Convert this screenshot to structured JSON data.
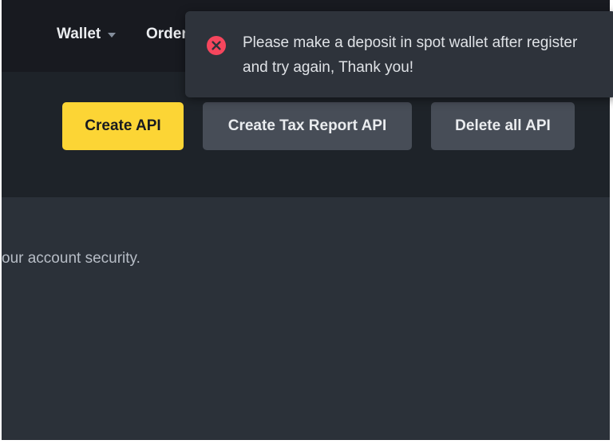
{
  "nav": {
    "wallet_label": "Wallet",
    "orders_label": "Orders"
  },
  "actions": {
    "create_api_label": "Create API",
    "create_tax_report_api_label": "Create Tax Report API",
    "delete_all_api_label": "Delete all API"
  },
  "content": {
    "security_text": "our account security."
  },
  "toast": {
    "type": "error",
    "icon": "close-circle-icon",
    "message": "Please make a deposit in spot wallet after register and try again, Thank you!"
  },
  "colors": {
    "accent": "#fcd535",
    "error": "#f6465d",
    "topbar_background": "#181a20",
    "page_background": "#2b3139"
  }
}
